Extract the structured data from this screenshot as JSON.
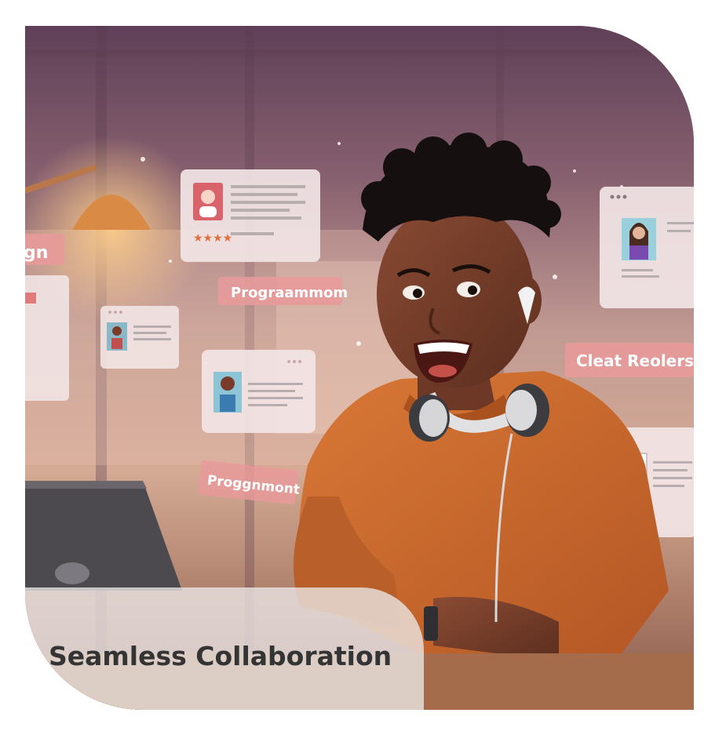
{
  "caption": {
    "title": "Seamless Collaboration"
  },
  "floating_tags": {
    "design": "gn",
    "programming_top": "Progrаammom",
    "programming_bottom": "Proggnmont",
    "client_request": "Cleat Reolerst"
  },
  "icons": {
    "rating_stars": "★★★★"
  },
  "colors": {
    "tag_pink": "#e79a9a",
    "shirt_orange": "#c96a2e",
    "caption_text": "#343434"
  }
}
